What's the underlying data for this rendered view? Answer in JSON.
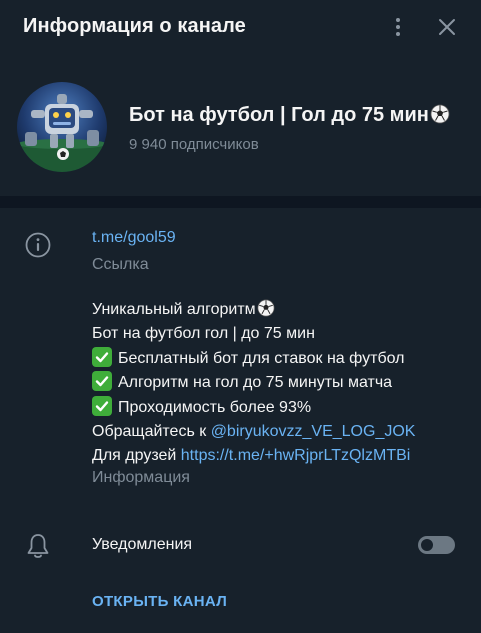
{
  "header": {
    "title": "Информация о канале",
    "menu_icon": "kebab-menu-icon",
    "close_icon": "close-icon"
  },
  "channel": {
    "name": "Бот на футбол | Гол до 75 мин",
    "name_emoji": "soccer-ball-icon",
    "subscribers": "9 940 подписчиков"
  },
  "info": {
    "icon": "info-icon",
    "link": "t.me/gool59",
    "link_caption": "Ссылка",
    "description": {
      "line1": "Уникальный алгоритм",
      "line2": "Бот на футбол гол | до 75 мин",
      "line3": "Бесплатный бот для ставок на футбол",
      "line4": "Алгоритм на гол до 75 минуты матча",
      "line5": "Проходимость более 93%",
      "line6_prefix": "Обращайтесь к ",
      "line6_mention": "@biryukovzz_VE_LOG_JOK",
      "line7_prefix": "Для друзей ",
      "line7_link": "https://t.me/+hwRjprLTzQlzMTBi"
    },
    "description_caption": "Информация"
  },
  "notifications": {
    "icon": "bell-icon",
    "label": "Уведомления",
    "enabled": false
  },
  "actions": {
    "open_channel": "ОТКРЫТЬ КАНАЛ"
  },
  "colors": {
    "background": "#17212b",
    "separator": "#0e1621",
    "accent": "#6ab3f3",
    "secondary_text": "#7f8b97",
    "check_green": "#3fad3a"
  }
}
